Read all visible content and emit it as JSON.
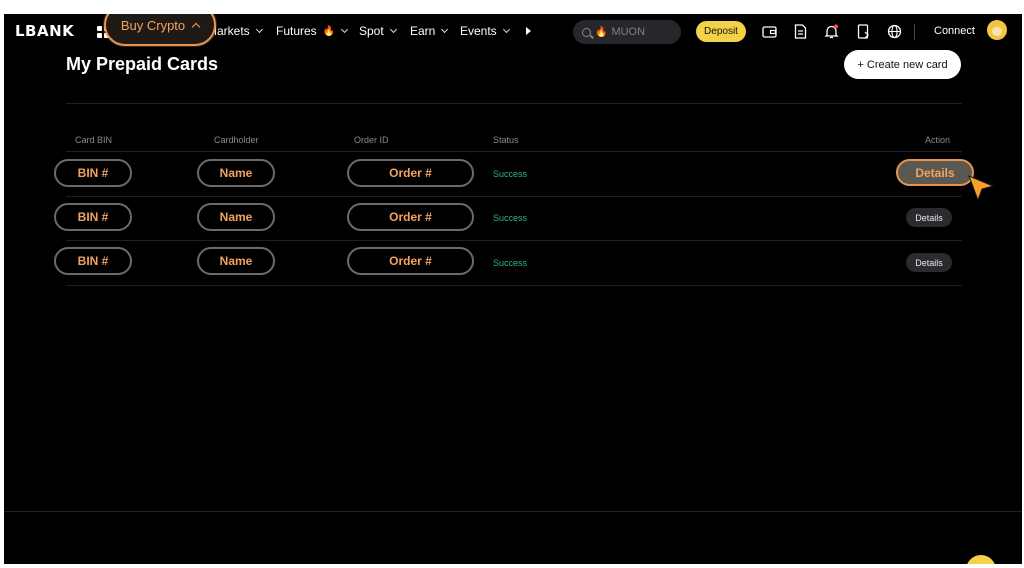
{
  "nav": {
    "logo": "LBANK",
    "buy_crypto": "Buy Crypto",
    "items": [
      {
        "label": "Markets"
      },
      {
        "label": "Futures"
      },
      {
        "label": "Spot"
      },
      {
        "label": "Earn"
      },
      {
        "label": "Events"
      }
    ],
    "search_placeholder": "MUON",
    "deposit": "Deposit",
    "connect": "Connect"
  },
  "page": {
    "title": "My Prepaid Cards",
    "create_button": "+ Create new card"
  },
  "table": {
    "columns": [
      "Card BIN",
      "Cardholder",
      "Order ID",
      "Status",
      "Action"
    ],
    "rows": [
      {
        "bin": "BIN #",
        "name": "Name",
        "order": "Order #",
        "status": "Success",
        "action": "Details"
      },
      {
        "bin": "BIN #",
        "name": "Name",
        "order": "Order #",
        "status": "Success",
        "action": "Details"
      },
      {
        "bin": "BIN #",
        "name": "Name",
        "order": "Order #",
        "status": "Success",
        "action": "Details"
      }
    ]
  },
  "colors": {
    "accent_orange": "#e8944d",
    "deposit_yellow": "#f3d247",
    "success_green": "#2fb87a",
    "background": "#000000"
  },
  "icons": [
    "grid-icon",
    "chevron-up-icon",
    "chevron-down-icon",
    "fire-icon",
    "play-icon",
    "search-icon",
    "wallet-icon",
    "document-icon",
    "bell-icon",
    "download-icon",
    "globe-icon",
    "avatar",
    "cursor-icon"
  ]
}
